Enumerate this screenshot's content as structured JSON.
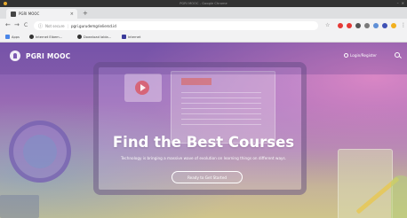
{
  "window": {
    "title": "PGRI MOOC - Google Chrome"
  },
  "tab": {
    "label": "PGRI MOOC",
    "close": "×",
    "new": "+"
  },
  "toolbar": {
    "back": "←",
    "forward": "→",
    "reload": "C",
    "info_icon": "info-icon",
    "security": "Not secure",
    "url": "pgri.gurudemgrieliersd.id",
    "star": "☆",
    "menu": "⋮"
  },
  "bookmarks": [
    {
      "label": "Apps",
      "color": "#4a86e8"
    },
    {
      "label": "Internet Eibem...",
      "color": "#333333"
    },
    {
      "label": "Download lalda...",
      "color": "#333333"
    },
    {
      "label": "Internet",
      "color": "#3b3b9b"
    }
  ],
  "extensions": [
    "#b0b0b0",
    "#e53935",
    "#e53935",
    "#555555",
    "#7a7a7a",
    "#5f8fd6",
    "#7a7a7a",
    "#3f51b5",
    "#f2b01e"
  ],
  "site": {
    "brand": "PGRI MOOC",
    "login": "Login/Register",
    "hero_title": "Find the Best Courses",
    "hero_sub": "Technology is bringing a massive wave of evolution on learning things on different ways.",
    "hero_button": "Ready to Get Started"
  },
  "colors": {
    "accent": "#7e5bb3"
  }
}
